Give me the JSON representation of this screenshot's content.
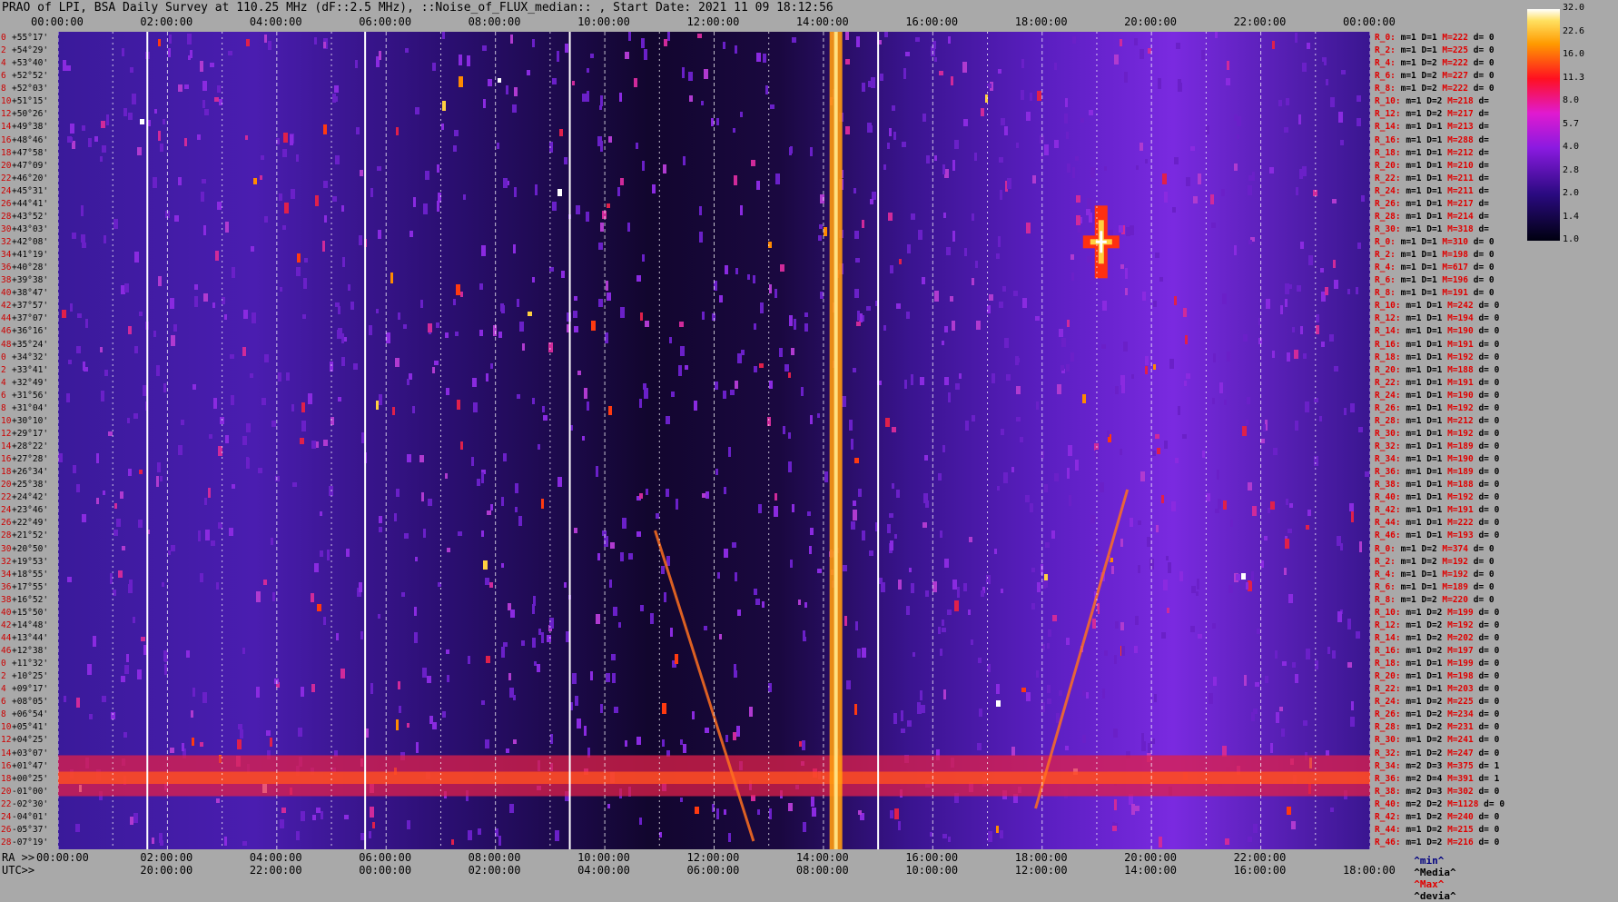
{
  "title": "PRAO of LPI, BSA Daily Survey at 110.25 MHz (dF::2.5 MHz), ::Noise_of_FLUX_median:: , Start Date: 2021 11 09 18:12:56",
  "chart_data": {
    "type": "heatmap",
    "top_ticks": [
      "00:00:00",
      "02:00:00",
      "04:00:00",
      "06:00:00",
      "08:00:00",
      "10:00:00",
      "12:00:00",
      "14:00:00",
      "16:00:00",
      "18:00:00",
      "20:00:00",
      "22:00:00",
      "00:00:00"
    ],
    "ra_prefix": "RA >>",
    "ra_ticks": [
      "00:00:00",
      "02:00:00",
      "04:00:00",
      "06:00:00",
      "08:00:00",
      "10:00:00",
      "12:00:00",
      "14:00:00",
      "16:00:00",
      "18:00:00",
      "20:00:00",
      "22:00:00"
    ],
    "utc_prefix": "UTC>>",
    "utc_ticks": [
      "20:00:00",
      "22:00:00",
      "00:00:00",
      "02:00:00",
      "04:00:00",
      "06:00:00",
      "08:00:00",
      "10:00:00",
      "12:00:00",
      "14:00:00",
      "16:00:00",
      "18:00:00"
    ],
    "colorbar_ticks": [
      "32.0",
      "22.6",
      "16.0",
      "11.3",
      "8.0",
      "5.7",
      "4.0",
      "2.8",
      "2.0",
      "1.4",
      "1.0"
    ],
    "y_labels": [
      "+55°17'",
      "+54°29'",
      "+53°40'",
      "+52°52'",
      "+52°03'",
      "+51°15'",
      "+50°26'",
      "+49°38'",
      "+48°46'",
      "+47°58'",
      "+47°09'",
      "+46°20'",
      "+45°31'",
      "+44°41'",
      "+43°52'",
      "+43°03'",
      "+42°08'",
      "+41°19'",
      "+40°28'",
      "+39°38'",
      "+38°47'",
      "+37°57'",
      "+37°07'",
      "+36°16'",
      "+35°24'",
      "+34°32'",
      "+33°41'",
      "+32°49'",
      "+31°56'",
      "+31°04'",
      "+30°10'",
      "+29°17'",
      "+28°22'",
      "+27°28'",
      "+26°34'",
      "+25°38'",
      "+24°42'",
      "+23°46'",
      "+22°49'",
      "+21°52'",
      "+20°50'",
      "+19°53'",
      "+18°55'",
      "+17°55'",
      "+16°52'",
      "+15°50'",
      "+14°48'",
      "+13°44'",
      "+12°38'",
      "+11°32'",
      "+10°25'",
      "+09°17'",
      "+08°05'",
      "+06°54'",
      "+05°41'",
      "+04°25'",
      "+03°07'",
      "+01°47'",
      "+00°25'",
      "-01°00'",
      "-02°30'",
      "-04°01'",
      "-05°37'",
      "-07°19'"
    ],
    "y_index": [
      "0",
      "2",
      "4",
      "6",
      "8",
      "10",
      "12",
      "14",
      "16",
      "18",
      "20",
      "22",
      "24",
      "26",
      "28",
      "30",
      "32",
      "34",
      "36",
      "38",
      "40",
      "42",
      "44",
      "46",
      "48",
      "0",
      "2",
      "4",
      "6",
      "8",
      "10",
      "12",
      "14",
      "16",
      "18",
      "20",
      "22",
      "24",
      "26",
      "28",
      "30",
      "32",
      "34",
      "36",
      "38",
      "40",
      "42",
      "44",
      "46",
      "0",
      "2",
      "4",
      "6",
      "8",
      "10",
      "12",
      "14",
      "16",
      "18",
      "20",
      "22",
      "24",
      "26",
      "28"
    ],
    "stats": [
      {
        "r": "R_0:",
        "m": "m=1",
        "d": "D=1",
        "M": "M=222",
        "dv": "d= 0"
      },
      {
        "r": "R_2:",
        "m": "m=1",
        "d": "D=1",
        "M": "M=225",
        "dv": "d= 0"
      },
      {
        "r": "R_4:",
        "m": "m=1",
        "d": "D=2",
        "M": "M=222",
        "dv": "d= 0"
      },
      {
        "r": "R_6:",
        "m": "m=1",
        "d": "D=2",
        "M": "M=227",
        "dv": "d= 0"
      },
      {
        "r": "R_8:",
        "m": "m=1",
        "d": "D=2",
        "M": "M=222",
        "dv": "d= 0"
      },
      {
        "r": "R_10:",
        "m": "m=1",
        "d": "D=2",
        "M": "M=218",
        "dv": "d="
      },
      {
        "r": "R_12:",
        "m": "m=1",
        "d": "D=2",
        "M": "M=217",
        "dv": "d="
      },
      {
        "r": "R_14:",
        "m": "m=1",
        "d": "D=1",
        "M": "M=213",
        "dv": "d="
      },
      {
        "r": "R_16:",
        "m": "m=1",
        "d": "D=1",
        "M": "M=288",
        "dv": "d="
      },
      {
        "r": "R_18:",
        "m": "m=1",
        "d": "D=1",
        "M": "M=212",
        "dv": "d="
      },
      {
        "r": "R_20:",
        "m": "m=1",
        "d": "D=1",
        "M": "M=210",
        "dv": "d="
      },
      {
        "r": "R_22:",
        "m": "m=1",
        "d": "D=1",
        "M": "M=211",
        "dv": "d="
      },
      {
        "r": "R_24:",
        "m": "m=1",
        "d": "D=1",
        "M": "M=211",
        "dv": "d="
      },
      {
        "r": "R_26:",
        "m": "m=1",
        "d": "D=1",
        "M": "M=217",
        "dv": "d="
      },
      {
        "r": "R_28:",
        "m": "m=1",
        "d": "D=1",
        "M": "M=214",
        "dv": "d="
      },
      {
        "r": "R_30:",
        "m": "m=1",
        "d": "D=1",
        "M": "M=318",
        "dv": "d="
      },
      {
        "r": "R_0:",
        "m": "m=1",
        "d": "D=1",
        "M": "M=310",
        "dv": "d= 0"
      },
      {
        "r": "R_2:",
        "m": "m=1",
        "d": "D=1",
        "M": "M=198",
        "dv": "d= 0"
      },
      {
        "r": "R_4:",
        "m": "m=1",
        "d": "D=1",
        "M": "M=617",
        "dv": "d= 0"
      },
      {
        "r": "R_6:",
        "m": "m=1",
        "d": "D=1",
        "M": "M=196",
        "dv": "d= 0"
      },
      {
        "r": "R_8:",
        "m": "m=1",
        "d": "D=1",
        "M": "M=191",
        "dv": "d= 0"
      },
      {
        "r": "R_10:",
        "m": "m=1",
        "d": "D=1",
        "M": "M=242",
        "dv": "d= 0"
      },
      {
        "r": "R_12:",
        "m": "m=1",
        "d": "D=1",
        "M": "M=194",
        "dv": "d= 0"
      },
      {
        "r": "R_14:",
        "m": "m=1",
        "d": "D=1",
        "M": "M=190",
        "dv": "d= 0"
      },
      {
        "r": "R_16:",
        "m": "m=1",
        "d": "D=1",
        "M": "M=191",
        "dv": "d= 0"
      },
      {
        "r": "R_18:",
        "m": "m=1",
        "d": "D=1",
        "M": "M=192",
        "dv": "d= 0"
      },
      {
        "r": "R_20:",
        "m": "m=1",
        "d": "D=1",
        "M": "M=188",
        "dv": "d= 0"
      },
      {
        "r": "R_22:",
        "m": "m=1",
        "d": "D=1",
        "M": "M=191",
        "dv": "d= 0"
      },
      {
        "r": "R_24:",
        "m": "m=1",
        "d": "D=1",
        "M": "M=190",
        "dv": "d= 0"
      },
      {
        "r": "R_26:",
        "m": "m=1",
        "d": "D=1",
        "M": "M=192",
        "dv": "d= 0"
      },
      {
        "r": "R_28:",
        "m": "m=1",
        "d": "D=1",
        "M": "M=212",
        "dv": "d= 0"
      },
      {
        "r": "R_30:",
        "m": "m=1",
        "d": "D=1",
        "M": "M=192",
        "dv": "d= 0"
      },
      {
        "r": "R_32:",
        "m": "m=1",
        "d": "D=1",
        "M": "M=189",
        "dv": "d= 0"
      },
      {
        "r": "R_34:",
        "m": "m=1",
        "d": "D=1",
        "M": "M=190",
        "dv": "d= 0"
      },
      {
        "r": "R_36:",
        "m": "m=1",
        "d": "D=1",
        "M": "M=189",
        "dv": "d= 0"
      },
      {
        "r": "R_38:",
        "m": "m=1",
        "d": "D=1",
        "M": "M=188",
        "dv": "d= 0"
      },
      {
        "r": "R_40:",
        "m": "m=1",
        "d": "D=1",
        "M": "M=192",
        "dv": "d= 0"
      },
      {
        "r": "R_42:",
        "m": "m=1",
        "d": "D=1",
        "M": "M=191",
        "dv": "d= 0"
      },
      {
        "r": "R_44:",
        "m": "m=1",
        "d": "D=1",
        "M": "M=222",
        "dv": "d= 0"
      },
      {
        "r": "R_46:",
        "m": "m=1",
        "d": "D=1",
        "M": "M=193",
        "dv": "d= 0"
      },
      {
        "r": "R_0:",
        "m": "m=1",
        "d": "D=2",
        "M": "M=374",
        "dv": "d= 0"
      },
      {
        "r": "R_2:",
        "m": "m=1",
        "d": "D=2",
        "M": "M=192",
        "dv": "d= 0"
      },
      {
        "r": "R_4:",
        "m": "m=1",
        "d": "D=1",
        "M": "M=192",
        "dv": "d= 0"
      },
      {
        "r": "R_6:",
        "m": "m=1",
        "d": "D=1",
        "M": "M=189",
        "dv": "d= 0"
      },
      {
        "r": "R_8:",
        "m": "m=1",
        "d": "D=2",
        "M": "M=220",
        "dv": "d= 0"
      },
      {
        "r": "R_10:",
        "m": "m=1",
        "d": "D=2",
        "M": "M=199",
        "dv": "d= 0"
      },
      {
        "r": "R_12:",
        "m": "m=1",
        "d": "D=2",
        "M": "M=192",
        "dv": "d= 0"
      },
      {
        "r": "R_14:",
        "m": "m=1",
        "d": "D=2",
        "M": "M=202",
        "dv": "d= 0"
      },
      {
        "r": "R_16:",
        "m": "m=1",
        "d": "D=2",
        "M": "M=197",
        "dv": "d= 0"
      },
      {
        "r": "R_18:",
        "m": "m=1",
        "d": "D=1",
        "M": "M=199",
        "dv": "d= 0"
      },
      {
        "r": "R_20:",
        "m": "m=1",
        "d": "D=1",
        "M": "M=198",
        "dv": "d= 0"
      },
      {
        "r": "R_22:",
        "m": "m=1",
        "d": "D=1",
        "M": "M=203",
        "dv": "d= 0"
      },
      {
        "r": "R_24:",
        "m": "m=1",
        "d": "D=2",
        "M": "M=225",
        "dv": "d= 0"
      },
      {
        "r": "R_26:",
        "m": "m=1",
        "d": "D=2",
        "M": "M=234",
        "dv": "d= 0"
      },
      {
        "r": "R_28:",
        "m": "m=1",
        "d": "D=2",
        "M": "M=231",
        "dv": "d= 0"
      },
      {
        "r": "R_30:",
        "m": "m=1",
        "d": "D=2",
        "M": "M=241",
        "dv": "d= 0"
      },
      {
        "r": "R_32:",
        "m": "m=1",
        "d": "D=2",
        "M": "M=247",
        "dv": "d= 0"
      },
      {
        "r": "R_34:",
        "m": "m=2",
        "d": "D=3",
        "M": "M=375",
        "dv": "d= 1"
      },
      {
        "r": "R_36:",
        "m": "m=2",
        "d": "D=4",
        "M": "M=391",
        "dv": "d= 1"
      },
      {
        "r": "R_38:",
        "m": "m=2",
        "d": "D=3",
        "M": "M=302",
        "dv": "d= 0"
      },
      {
        "r": "R_40:",
        "m": "m=2",
        "d": "D=2",
        "M": "M=1128",
        "dv": "d= 0"
      },
      {
        "r": "R_42:",
        "m": "m=1",
        "d": "D=2",
        "M": "M=240",
        "dv": "d= 0"
      },
      {
        "r": "R_44:",
        "m": "m=1",
        "d": "D=2",
        "M": "M=215",
        "dv": "d= 0"
      },
      {
        "r": "R_46:",
        "m": "m=1",
        "d": "D=2",
        "M": "M=216",
        "dv": "d= 0"
      }
    ],
    "legend": {
      "min": "^min^",
      "median": "^Media^",
      "max": "^Max^",
      "dev": "^devia^"
    },
    "colors": {
      "background": "#a9a9a9",
      "low": "#0a0520",
      "mid": "#7a1ad0",
      "high": "#ff2000",
      "peak": "#ffffff"
    }
  }
}
